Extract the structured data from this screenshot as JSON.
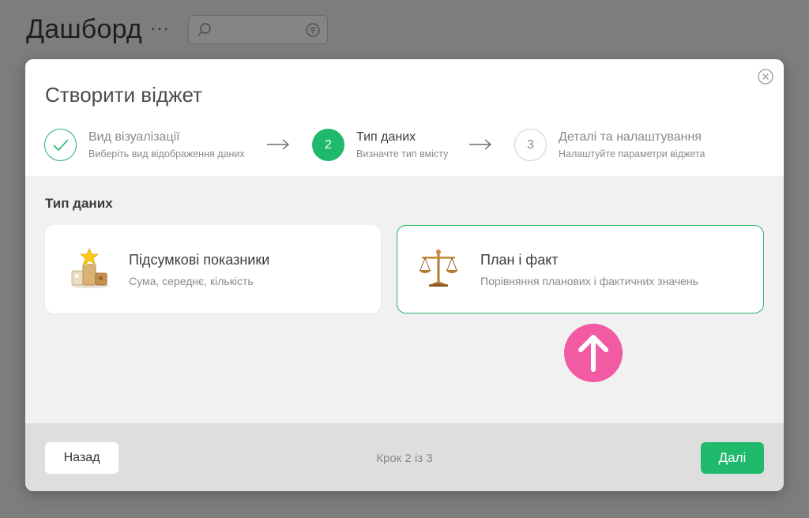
{
  "app": {
    "title": "Дашборд",
    "more_label": "···"
  },
  "modal": {
    "title": "Створити віджет",
    "steps": [
      {
        "number": "1",
        "title": "Вид візуалізації",
        "subtitle": "Виберіть вид відображення даних",
        "status": "completed"
      },
      {
        "number": "2",
        "title": "Тип даних",
        "subtitle": "Визначте тип вмісту",
        "status": "active"
      },
      {
        "number": "3",
        "title": "Деталі та налаштування",
        "subtitle": "Налаштуйте параметри віджета",
        "status": "pending"
      }
    ],
    "section_title": "Тип даних",
    "options": [
      {
        "title": "Підсумкові показники",
        "subtitle": "Сума, середнє, кількість",
        "icon": "podium-icon",
        "selected": false
      },
      {
        "title": "План і факт",
        "subtitle": "Порівняння планових і фактичних значень",
        "icon": "scales-icon",
        "selected": true
      }
    ],
    "footer": {
      "back_label": "Назад",
      "step_counter": "Крок 2 із 3",
      "next_label": "Далі"
    }
  },
  "colors": {
    "accent": "#1fb96c",
    "pointer": "#f25aa4"
  }
}
